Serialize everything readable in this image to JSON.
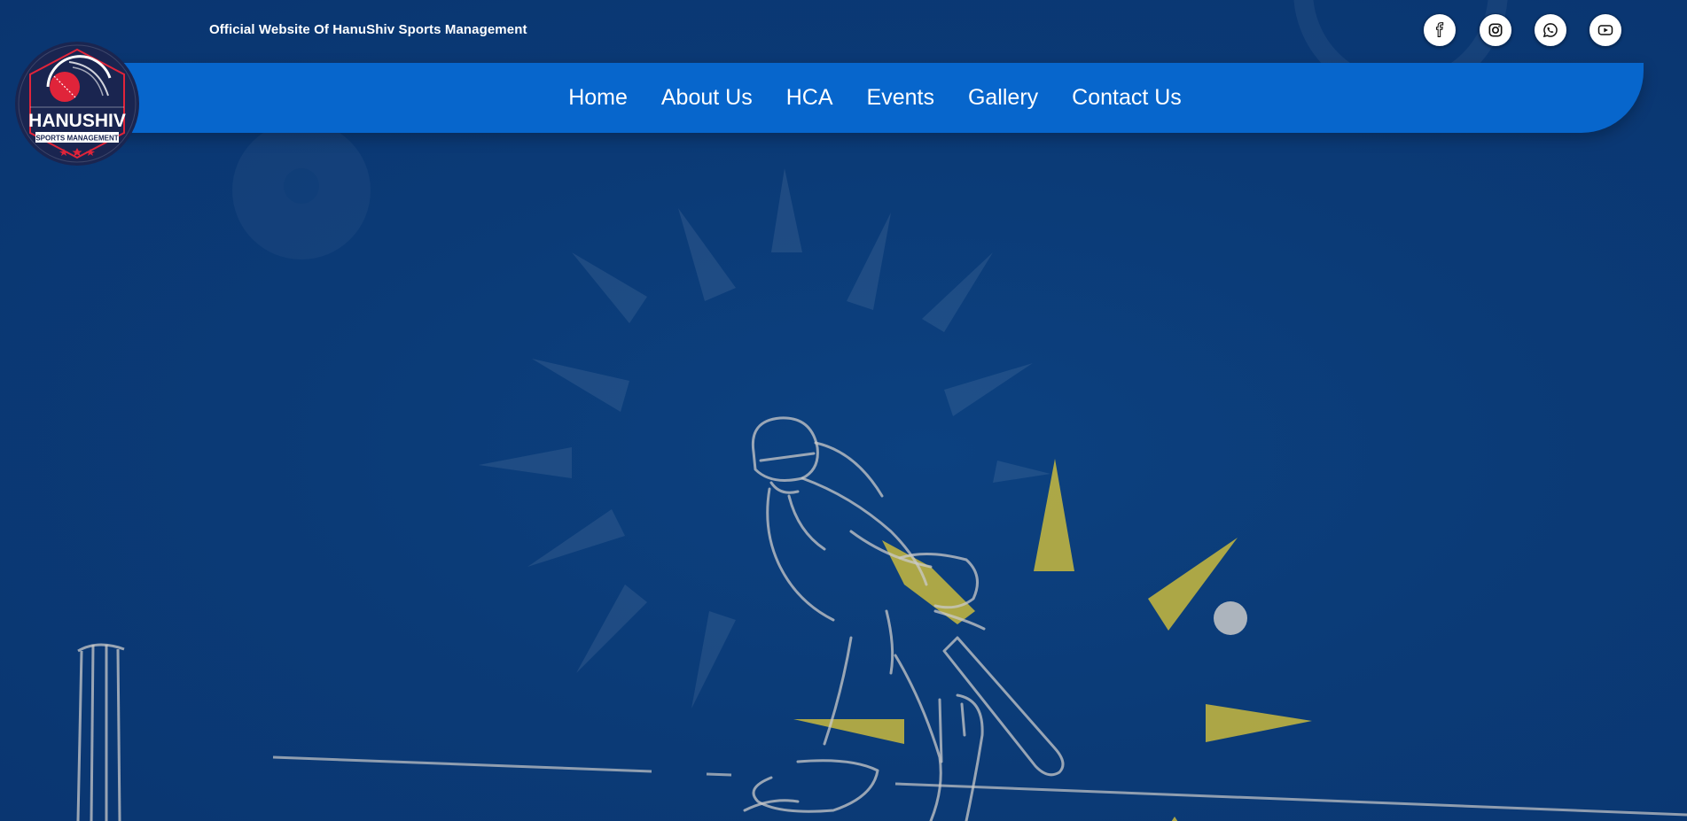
{
  "header": {
    "tagline": "Official Website Of HanuShiv Sports Management"
  },
  "social": [
    {
      "icon": "facebook-icon",
      "label": "Facebook"
    },
    {
      "icon": "instagram-icon",
      "label": "Instagram"
    },
    {
      "icon": "whatsapp-icon",
      "label": "WhatsApp"
    },
    {
      "icon": "youtube-icon",
      "label": "YouTube"
    }
  ],
  "logo": {
    "line1": "HANUSHIV",
    "line2": "SPORTS MANAGEMENT"
  },
  "nav": {
    "items": [
      "Home",
      "About Us",
      "HCA",
      "Events",
      "Gallery",
      "Contact Us"
    ]
  },
  "colors": {
    "background": "#0b3f7e",
    "navbar": "#0766cc",
    "logo_bg": "#1a2550",
    "logo_red": "#e0243a",
    "accent_yellow": "#d4c23a",
    "sketch_line": "#c9c9c9"
  }
}
